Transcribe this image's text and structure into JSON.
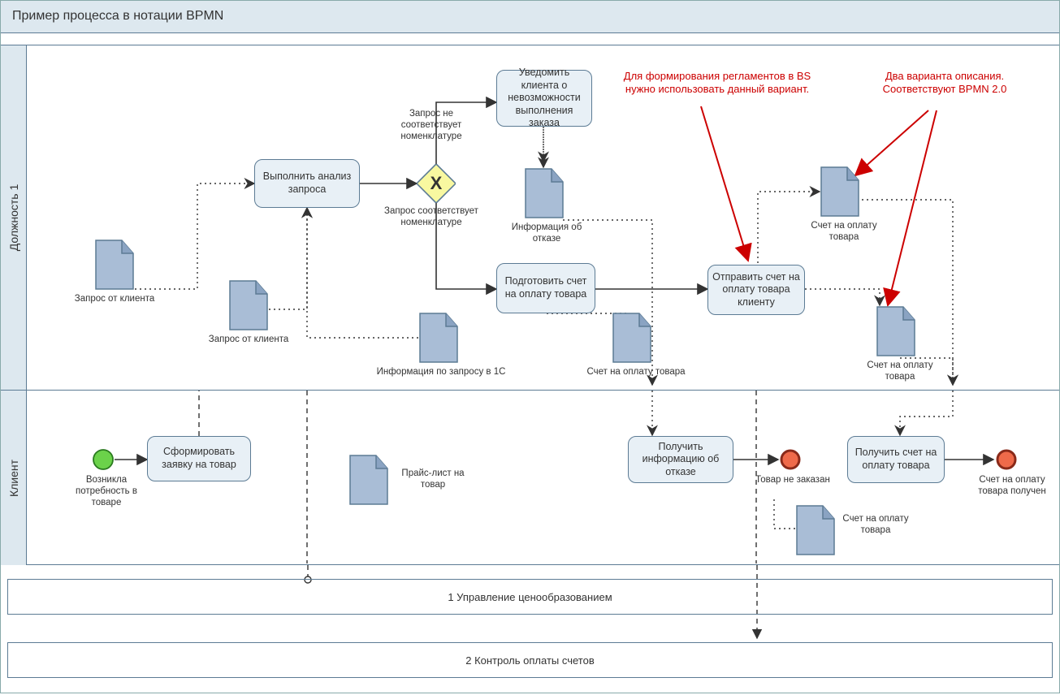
{
  "title": "Пример процесса в нотации BPMN",
  "lanes": {
    "lane1": "Должность 1",
    "lane2": "Клиент"
  },
  "tasks": {
    "analyze": "Выполнить анализ запроса",
    "notify": "Уведомить клиента о невозможности выполнения заказа",
    "prepare_invoice": "Подготовить счет на оплату товара",
    "send_invoice": "Отправить счет на оплату товара клиенту",
    "form_request": "Сформировать заявку на товар",
    "receive_reject": "Получить информацию об отказе",
    "receive_invoice": "Получить счет на оплату товара"
  },
  "gateway": {
    "glyph": "X"
  },
  "conditions": {
    "no_match": "Запрос не соответствует номенклатуре",
    "match": "Запрос соответствует номенклатуре"
  },
  "events": {
    "start": "Возникла потребность в товаре",
    "end_reject": "Товар не заказан",
    "end_invoice": "Счет на оплату товара получен"
  },
  "docs": {
    "req_client_1": "Запрос от клиента",
    "req_client_2": "Запрос от клиента",
    "info_1c": "Информация по запросу в 1С",
    "reject_info": "Информация об отказе",
    "invoice_1": "Счет на оплату товара",
    "invoice_2": "Счет на оплату товара",
    "invoice_3": "Счет на оплату товара",
    "pricelist": "Прайс-лист на товар",
    "invoice_4": "Счет на оплату товара"
  },
  "annotations": {
    "anno1": "Для формирования регламентов в BS нужно использовать данный вариант.",
    "anno2": "Два варианта описания. Соответствуют BPMN 2.0"
  },
  "subprocesses": {
    "sp1": "1 Управление ценообразованием",
    "sp2": "2 Контроль оплаты счетов"
  },
  "colors": {
    "task_fill": "#e8f0f6",
    "lane_fill": "#dde8ef",
    "doc_fill": "#a9bdd6",
    "gateway_fill": "#f8f8a0",
    "start_fill": "#6bd24a",
    "end_fill": "#ef6a4a",
    "anno_color": "#c00"
  }
}
